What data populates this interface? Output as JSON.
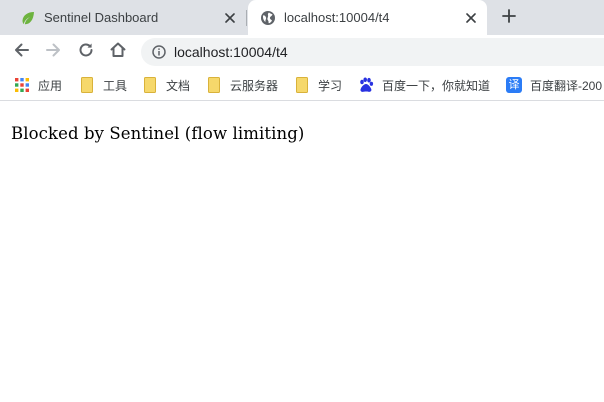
{
  "tabs": [
    {
      "title": "Sentinel Dashboard",
      "favicon": "leaf-icon",
      "active": false
    },
    {
      "title": "localhost:10004/t4",
      "favicon": "globe-icon",
      "active": true
    }
  ],
  "toolbar": {
    "back": "back-arrow-icon",
    "forward": "forward-arrow-icon",
    "reload": "reload-icon",
    "home": "home-icon",
    "info": "info-icon",
    "url": "localhost:10004/t4"
  },
  "bookmarks": [
    {
      "label": "应用",
      "icon": "apps-grid-icon"
    },
    {
      "label": "工具",
      "icon": "folder-icon"
    },
    {
      "label": "文档",
      "icon": "folder-icon"
    },
    {
      "label": "云服务器",
      "icon": "folder-icon"
    },
    {
      "label": "学习",
      "icon": "folder-icon"
    },
    {
      "label": "百度一下，你就知道",
      "icon": "baidu-paw-icon"
    },
    {
      "label": "百度翻译-200",
      "icon": "translate-icon",
      "icon_text": "译"
    }
  ],
  "content": {
    "message": "Blocked by Sentinel (flow limiting)"
  },
  "colors": {
    "tabstrip": "#dee1e6",
    "omnibox": "#f1f3f4",
    "folder": "#f6d86b",
    "baidu": "#2932e1",
    "translate": "#2b7cf6",
    "leaf": "#6db33f"
  }
}
